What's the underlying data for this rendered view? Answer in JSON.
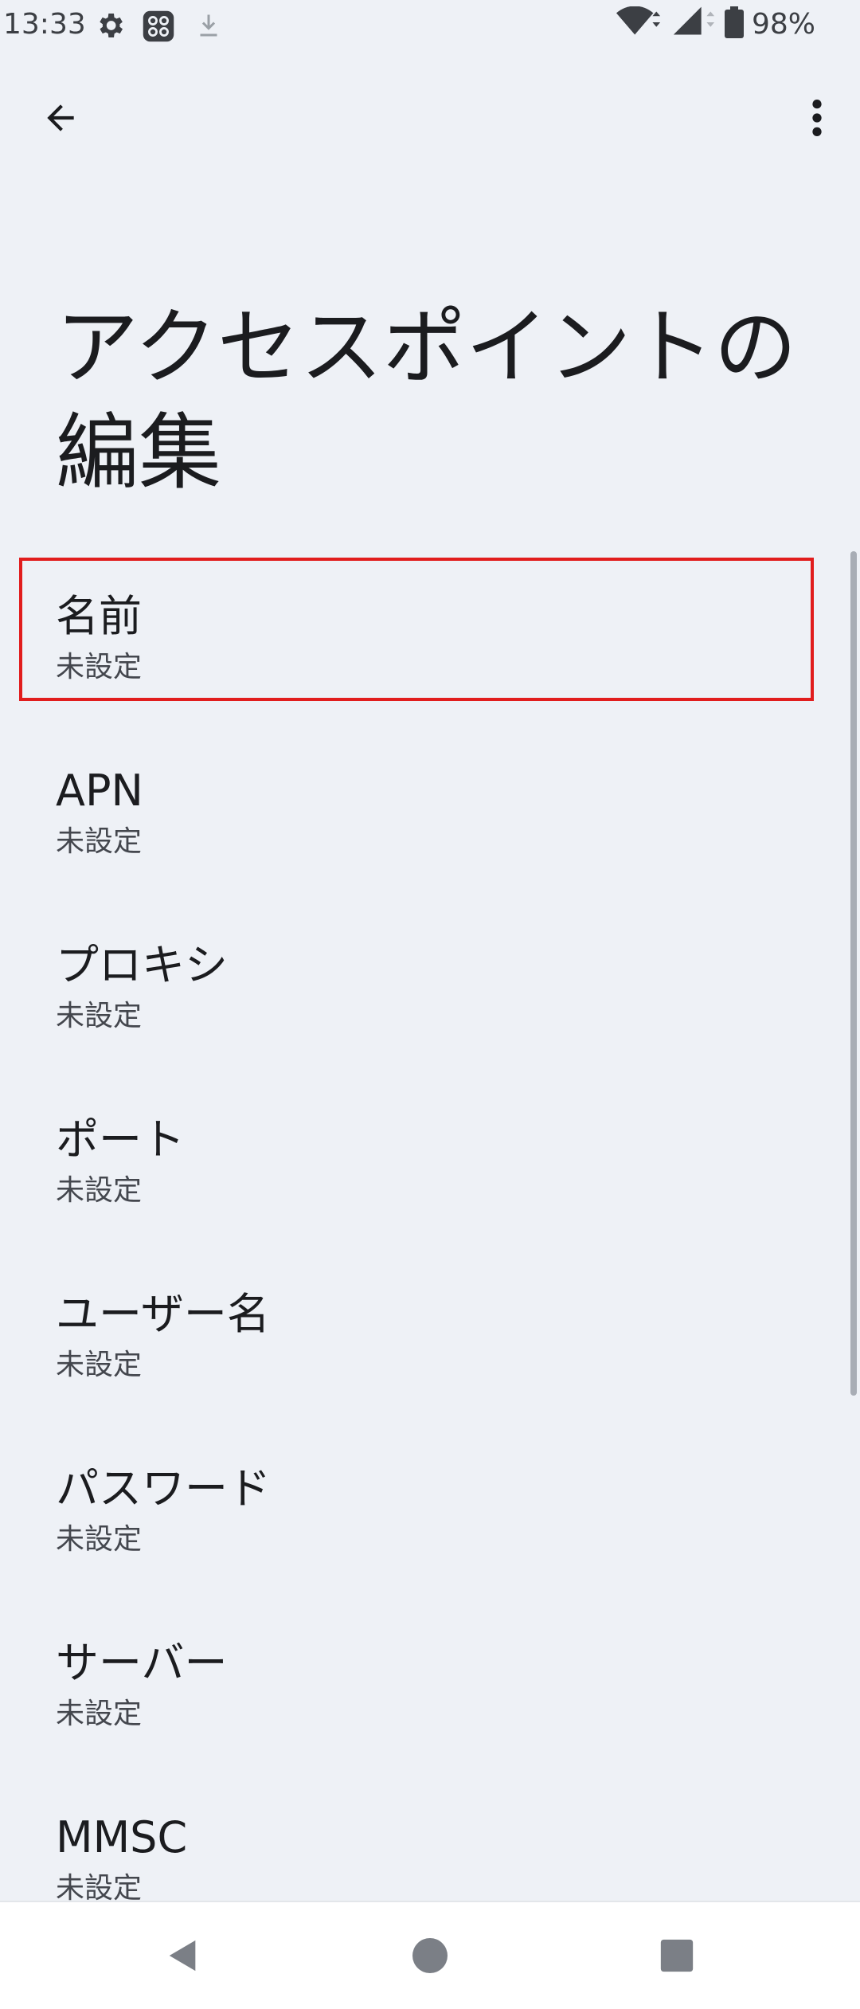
{
  "status_bar": {
    "time": "13:33",
    "battery": "98%"
  },
  "toolbar": {
    "back_icon": "arrow-back-icon",
    "more_icon": "more-vert-icon"
  },
  "page": {
    "title": "アクセスポイントの編集"
  },
  "fields": [
    {
      "title": "名前",
      "summary": "未設定"
    },
    {
      "title": "APN",
      "summary": "未設定"
    },
    {
      "title": "プロキシ",
      "summary": "未設定"
    },
    {
      "title": "ポート",
      "summary": "未設定"
    },
    {
      "title": "ユーザー名",
      "summary": "未設定"
    },
    {
      "title": "パスワード",
      "summary": "未設定"
    },
    {
      "title": "サーバー",
      "summary": "未設定"
    },
    {
      "title": "MMSC",
      "summary": "未設定"
    }
  ],
  "colors": {
    "background": "#eef1f6",
    "highlight_border": "#e11d1d",
    "text_primary": "#1b1c1f",
    "text_secondary": "#44474e"
  }
}
